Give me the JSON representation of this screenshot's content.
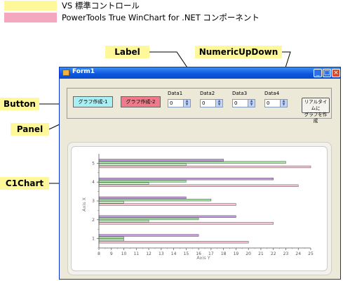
{
  "legend": {
    "items": [
      {
        "label": "VS 標準コントロール",
        "color": "#fff89a"
      },
      {
        "label": "PowerTools True WinChart for .NET コンポーネント",
        "color": "#f4a8c0"
      }
    ]
  },
  "callouts": {
    "label": "Label",
    "numeric_updown": "NumericUpDown",
    "button": "Button",
    "panel": "Panel",
    "c1chart": "C1Chart"
  },
  "window": {
    "title": "Form1",
    "controls": {
      "minimize": "_",
      "maximize": "□",
      "close": "×"
    },
    "buttons": {
      "graph1": "グラフ作成-1",
      "graph2": "グラフ作成-2",
      "realtime_line1": "リアルタイムに",
      "realtime_line2": "グラフを作成"
    },
    "data_fields": [
      {
        "label": "Data1",
        "value": "0"
      },
      {
        "label": "Data2",
        "value": "0"
      },
      {
        "label": "Data3",
        "value": "0"
      },
      {
        "label": "Data4",
        "value": "0"
      }
    ],
    "colors": {
      "graph1_bg": "#a8f0f4",
      "graph2_bg": "#f07a8a"
    }
  },
  "chart_data": {
    "type": "bar",
    "orientation": "horizontal",
    "categories": [
      "1",
      "2",
      "3",
      "4",
      "5"
    ],
    "x_axis_label": "Axis X",
    "y_axis_label": "Axis Y",
    "y_ticks": [
      "8",
      "9",
      "10",
      "11",
      "12",
      "13",
      "14",
      "15",
      "16",
      "17",
      "18",
      "19",
      "20",
      "21",
      "22",
      "23",
      "24",
      "25"
    ],
    "ylim": [
      8,
      25
    ],
    "series": [
      {
        "color": "#f4c6d4",
        "values": [
          20,
          22,
          19,
          24,
          25
        ]
      },
      {
        "color": "#c6f2c6",
        "values": [
          10,
          12,
          10,
          12,
          15
        ]
      },
      {
        "color": "#a0e4a0",
        "values": [
          10,
          16,
          17,
          15,
          23
        ]
      },
      {
        "color": "#c79be0",
        "values": [
          16,
          19,
          15,
          22,
          18
        ]
      }
    ]
  }
}
